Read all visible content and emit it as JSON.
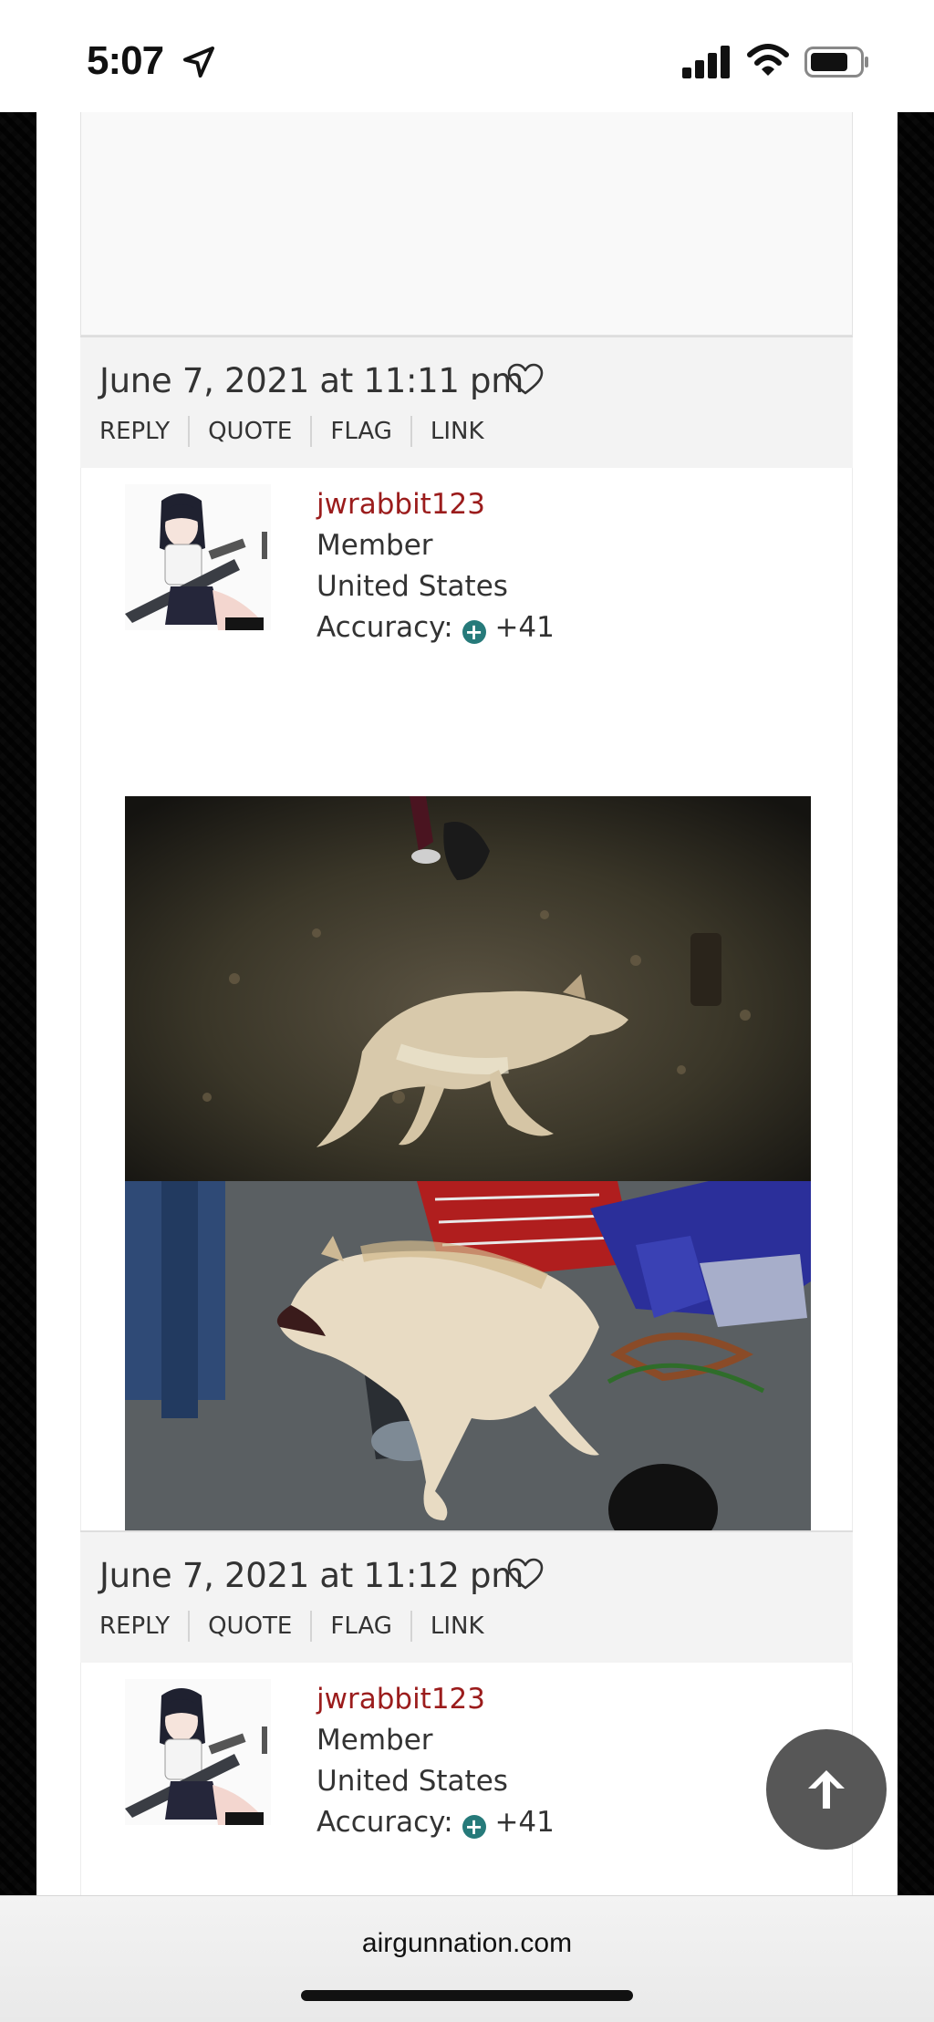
{
  "status_bar": {
    "time": "5:07"
  },
  "posts": [
    {
      "date": "June 7, 2021 at 11:11 pm",
      "actions": [
        "REPLY",
        "QUOTE",
        "FLAG",
        "LINK"
      ],
      "author": {
        "username": "jwrabbit123",
        "role": "Member",
        "country": "United States",
        "accuracy_label": "Accuracy:",
        "accuracy_value": "+41"
      }
    },
    {
      "date": "June 7, 2021 at 11:12 pm",
      "actions": [
        "REPLY",
        "QUOTE",
        "FLAG",
        "LINK"
      ],
      "author": {
        "username": "jwrabbit123",
        "role": "Member",
        "country": "United States",
        "accuracy_label": "Accuracy:",
        "accuracy_value": "+41"
      }
    }
  ],
  "browser": {
    "url": "airgunnation.com"
  },
  "icons": {
    "scroll_top": "arrow-up-icon",
    "favorite": "heart-icon",
    "accuracy": "plus-circle-icon"
  },
  "colors": {
    "username": "#9b1c1c",
    "accuracy_icon": "#267a7a",
    "scroll_button": "#575757"
  }
}
